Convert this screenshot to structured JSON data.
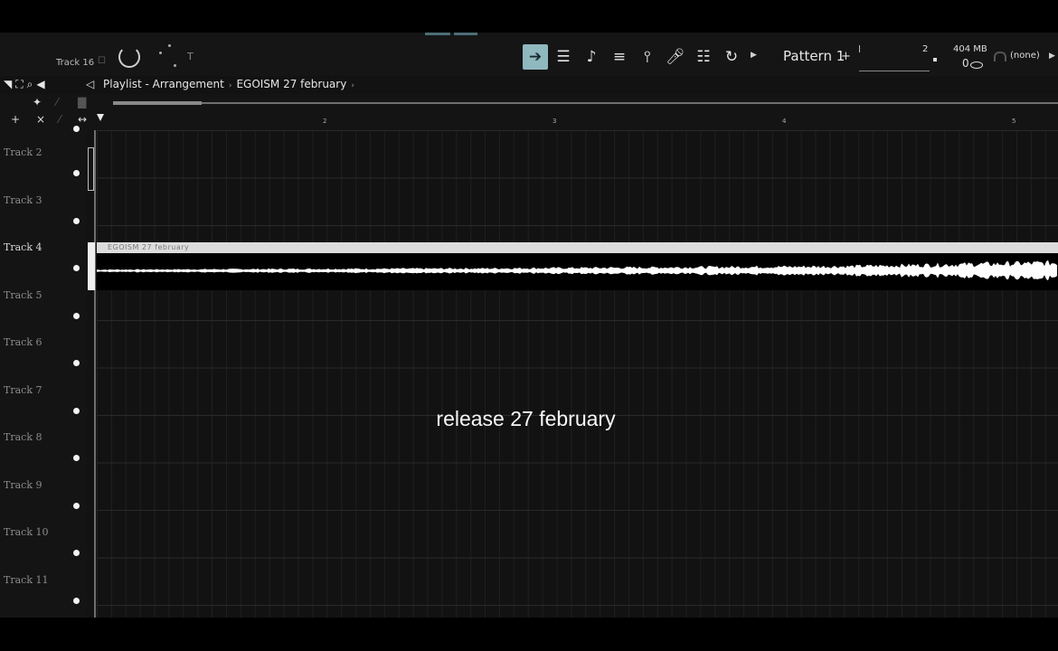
{
  "toolbar": {
    "track_label": "Track 16",
    "t_label": "T",
    "pattern_label": "Pattern 1",
    "pattern_plus": "+",
    "pattern_number": "2",
    "memory": "404 MB",
    "memory_value": "0",
    "output_device": "(none)",
    "icons": [
      "arrow-right-icon",
      "playlist-icon",
      "piano-roll-icon",
      "channel-rack-icon",
      "mixer-icon",
      "microphone-icon",
      "browser-tree-icon",
      "loop-icon"
    ]
  },
  "playlist": {
    "title": "Playlist - Arrangement",
    "breadcrumb_separator": "›",
    "current_pattern": "EGOISM 27 february",
    "bars": [
      "2",
      "3",
      "4",
      "5"
    ]
  },
  "tracks": [
    {
      "name": "Track 2",
      "active": false
    },
    {
      "name": "Track 3",
      "active": false
    },
    {
      "name": "Track 4",
      "active": true
    },
    {
      "name": "Track 5",
      "active": false
    },
    {
      "name": "Track 6",
      "active": false
    },
    {
      "name": "Track 7",
      "active": false
    },
    {
      "name": "Track 8",
      "active": false
    },
    {
      "name": "Track 9",
      "active": false
    },
    {
      "name": "Track 10",
      "active": false
    },
    {
      "name": "Track 11",
      "active": false
    }
  ],
  "clip": {
    "title": "EGOISM 27 february"
  },
  "caption": "release 27 february",
  "colors": {
    "accent": "#8fb8bf",
    "background": "#141414",
    "clip_header": "#dcdcdc",
    "waveform": "#ffffff"
  }
}
